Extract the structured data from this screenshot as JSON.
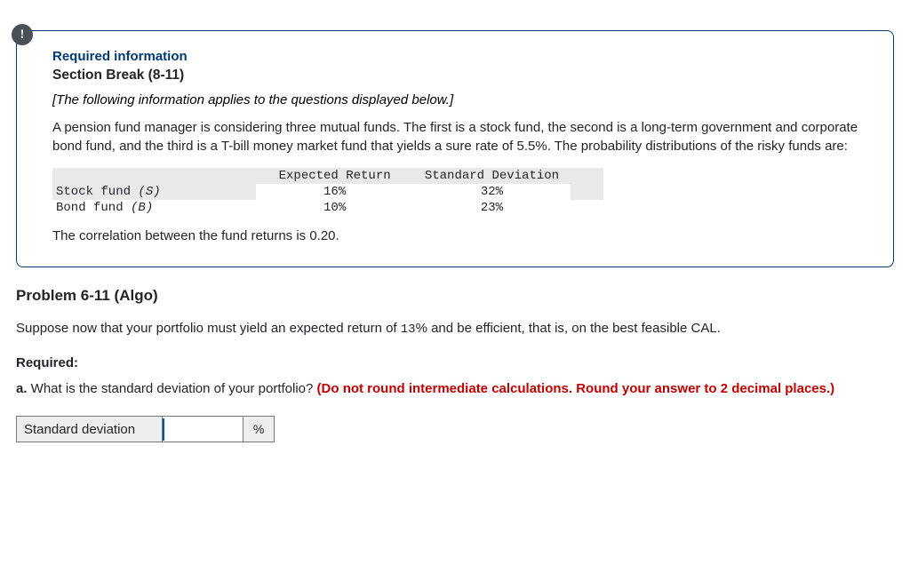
{
  "info_badge": "!",
  "req_info_label": "Required information",
  "section_break": "Section Break (8-11)",
  "italic_note": "[The following information applies to the questions displayed below.]",
  "scenario_text": "A pension fund manager is considering three mutual funds. The first is a stock fund, the second is a long-term government and corporate bond fund, and the third is a T-bill money market fund that yields a sure rate of 5.5%. The probability distributions of the risky funds are:",
  "table": {
    "headers": {
      "col1": "Expected Return",
      "col2": "Standard Deviation"
    },
    "rows": [
      {
        "name": "Stock fund (S)",
        "name_html": "Stock fund <i>(S)</i>",
        "er": "16%",
        "sd": "32%"
      },
      {
        "name": "Bond fund (B)",
        "name_html": "Bond fund <i>(B)</i>",
        "er": "10%",
        "sd": "23%"
      }
    ]
  },
  "correlation_text": "The correlation between the fund returns is 0.20.",
  "problem_title": "Problem 6-11 (Algo)",
  "question_intro_pre": "Suppose now that your portfolio must yield an expected return of ",
  "question_intro_pct": "13",
  "question_intro_post": "% and be efficient, that is, on the best feasible CAL.",
  "required_label": "Required:",
  "part_a": {
    "label": "a.",
    "text": " What is the standard deviation of your portfolio? ",
    "red_note": "(Do not round intermediate calculations. Round your answer to 2 decimal places.)"
  },
  "answer": {
    "label": "Standard deviation",
    "value": "",
    "unit": "%"
  }
}
